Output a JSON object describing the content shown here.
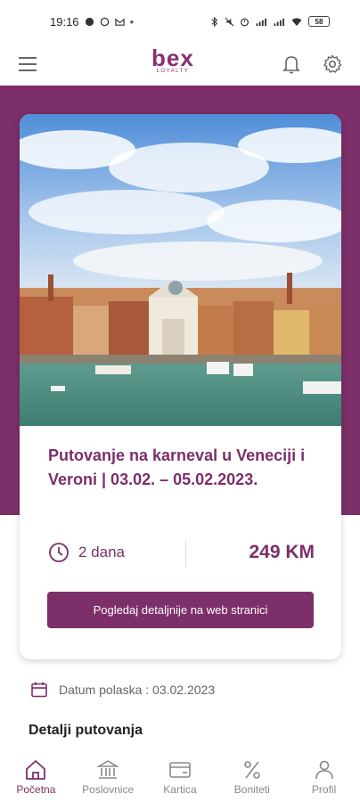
{
  "status": {
    "time": "19:16",
    "battery": "58"
  },
  "app": {
    "logo_main": "bex",
    "logo_sub": "LOYALTY"
  },
  "trip": {
    "title": "Putovanje na karneval u Veneciji i Veroni | 03.02. – 05.02.2023.",
    "duration": "2 dana",
    "price": "249 KM",
    "details_button": "Pogledaj detaljnije na web stranici",
    "departure": "Datum polaska : 03.02.2023"
  },
  "section": {
    "title": "Detalji putovanja"
  },
  "nav": {
    "items": [
      {
        "label": "Početna",
        "icon": "home-icon",
        "active": true
      },
      {
        "label": "Poslovnice",
        "icon": "bank-icon",
        "active": false
      },
      {
        "label": "Kartica",
        "icon": "card-icon",
        "active": false
      },
      {
        "label": "Boniteti",
        "icon": "percent-icon",
        "active": false
      },
      {
        "label": "Profil",
        "icon": "person-icon",
        "active": false
      }
    ]
  },
  "colors": {
    "brand": "#7c2f68"
  }
}
